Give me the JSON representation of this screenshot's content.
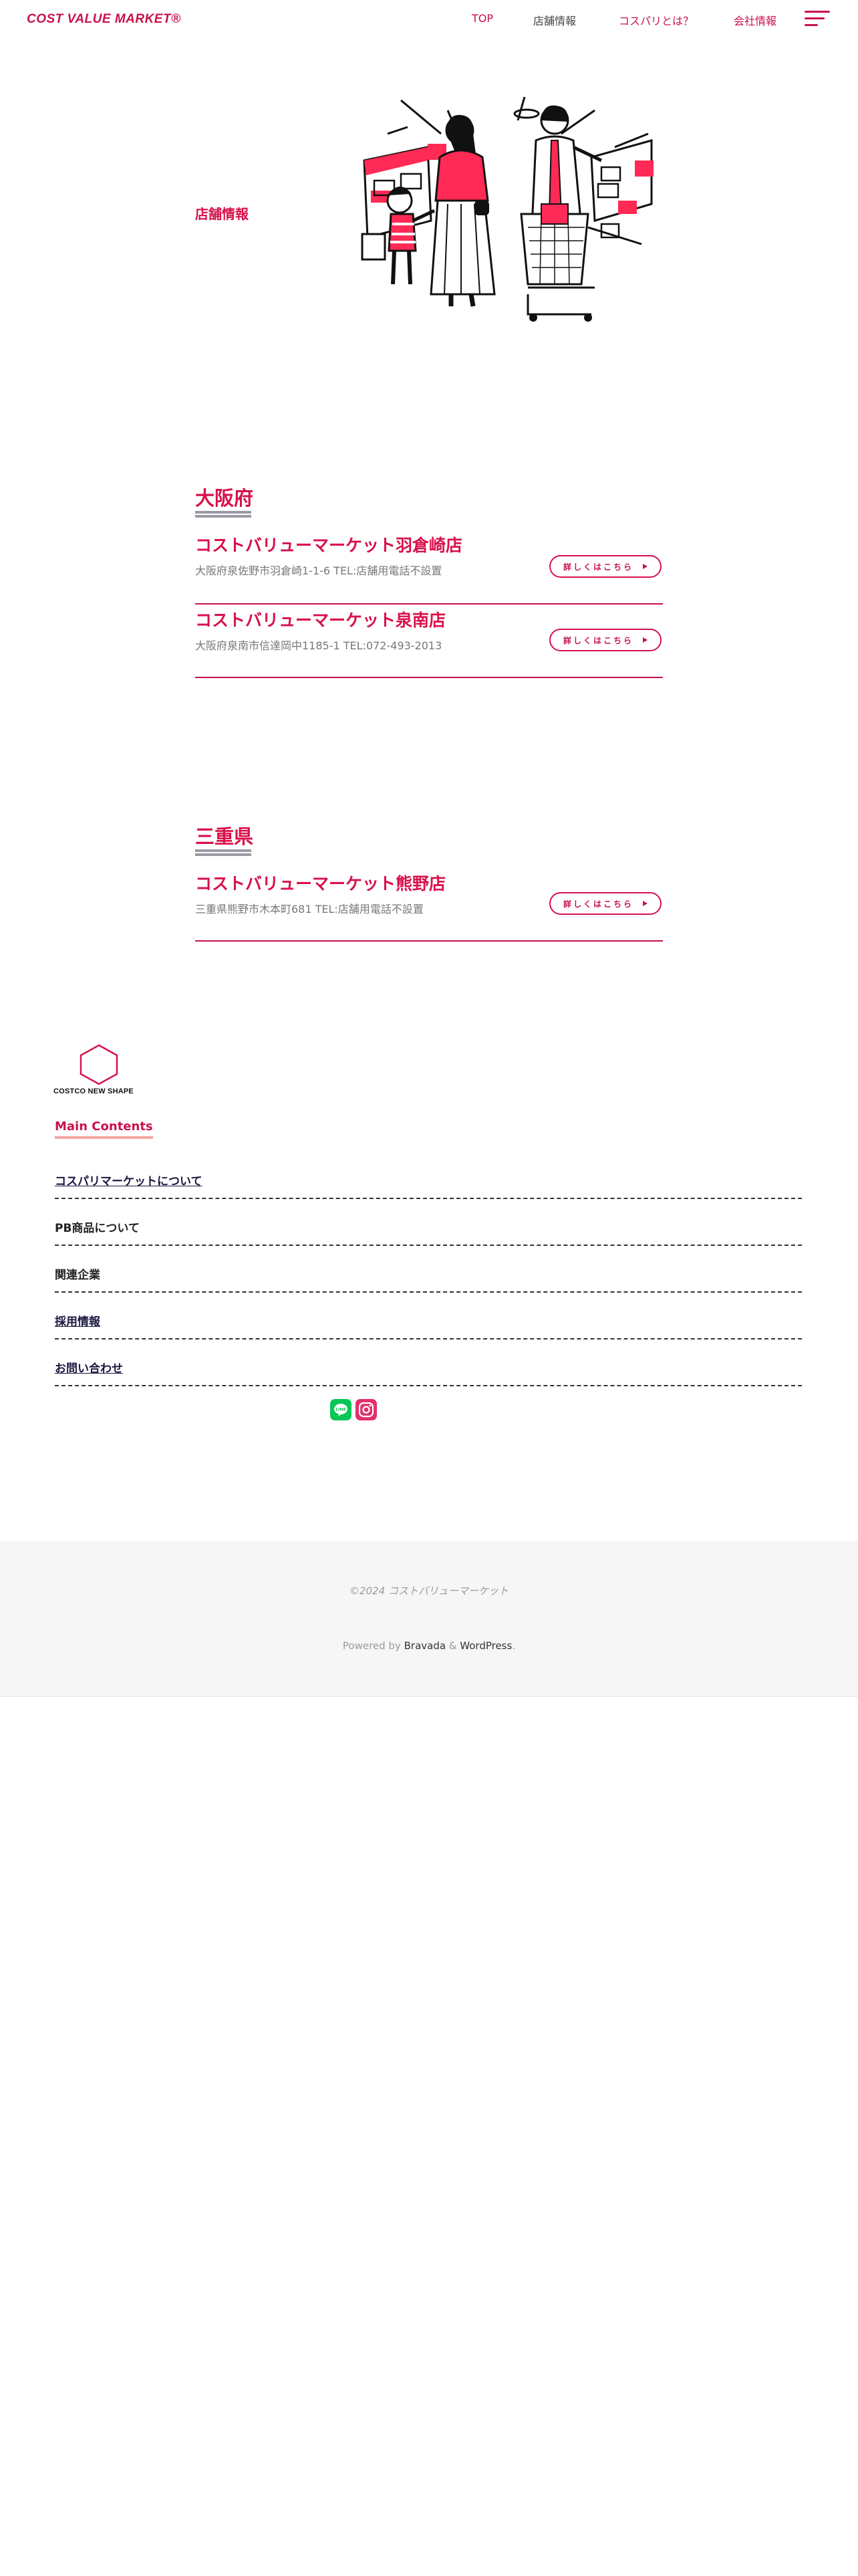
{
  "header": {
    "logo": "COST VALUE MARKET®",
    "nav": [
      "TOP",
      "店舗情報",
      "コスパリとは？",
      "会社情報"
    ]
  },
  "hero": {
    "title": "店舗情報"
  },
  "prefectures": [
    {
      "name": "大阪府",
      "stores": [
        {
          "name": "コストバリューマーケット羽倉崎店",
          "address": "大阪府泉佐野市羽倉崎1-1-6 TEL:店舗用電話不設置",
          "button": "詳しくはこちら"
        },
        {
          "name": "コストバリューマーケット泉南店",
          "address": "大阪府泉南市信達岡中1185-1 TEL:072-493-2013",
          "button": "詳しくはこちら"
        }
      ]
    },
    {
      "name": "三重県",
      "stores": [
        {
          "name": "コストバリューマーケット熊野店",
          "address": "三重県熊野市木本町681 TEL:店舗用電話不設置",
          "button": "詳しくはこちら"
        }
      ]
    }
  ],
  "footer": {
    "logo_text": "COSTCO NEW SHAPE",
    "main_contents_title": "Main Contents",
    "menu": [
      "コスパリマーケットについて",
      "PB商品について",
      "関連企業",
      "採用情報",
      "お問い合わせ"
    ],
    "social": [
      {
        "icon": "line-icon",
        "label": "LINE",
        "color": "#06c755"
      },
      {
        "icon": "instagram-icon",
        "label": "Instagram",
        "color": "#e1306c"
      }
    ],
    "copyright": "©2024 コストバリューマーケット",
    "powered_prefix": "Powered by ",
    "powered_link1": "Bravada",
    "powered_mid": " & ",
    "powered_link2": "WordPress",
    "powered_suffix": "."
  },
  "colors": {
    "accent": "#d8114b",
    "footer_bg": "#f6f6f6",
    "underline": "#f3a6a0"
  }
}
